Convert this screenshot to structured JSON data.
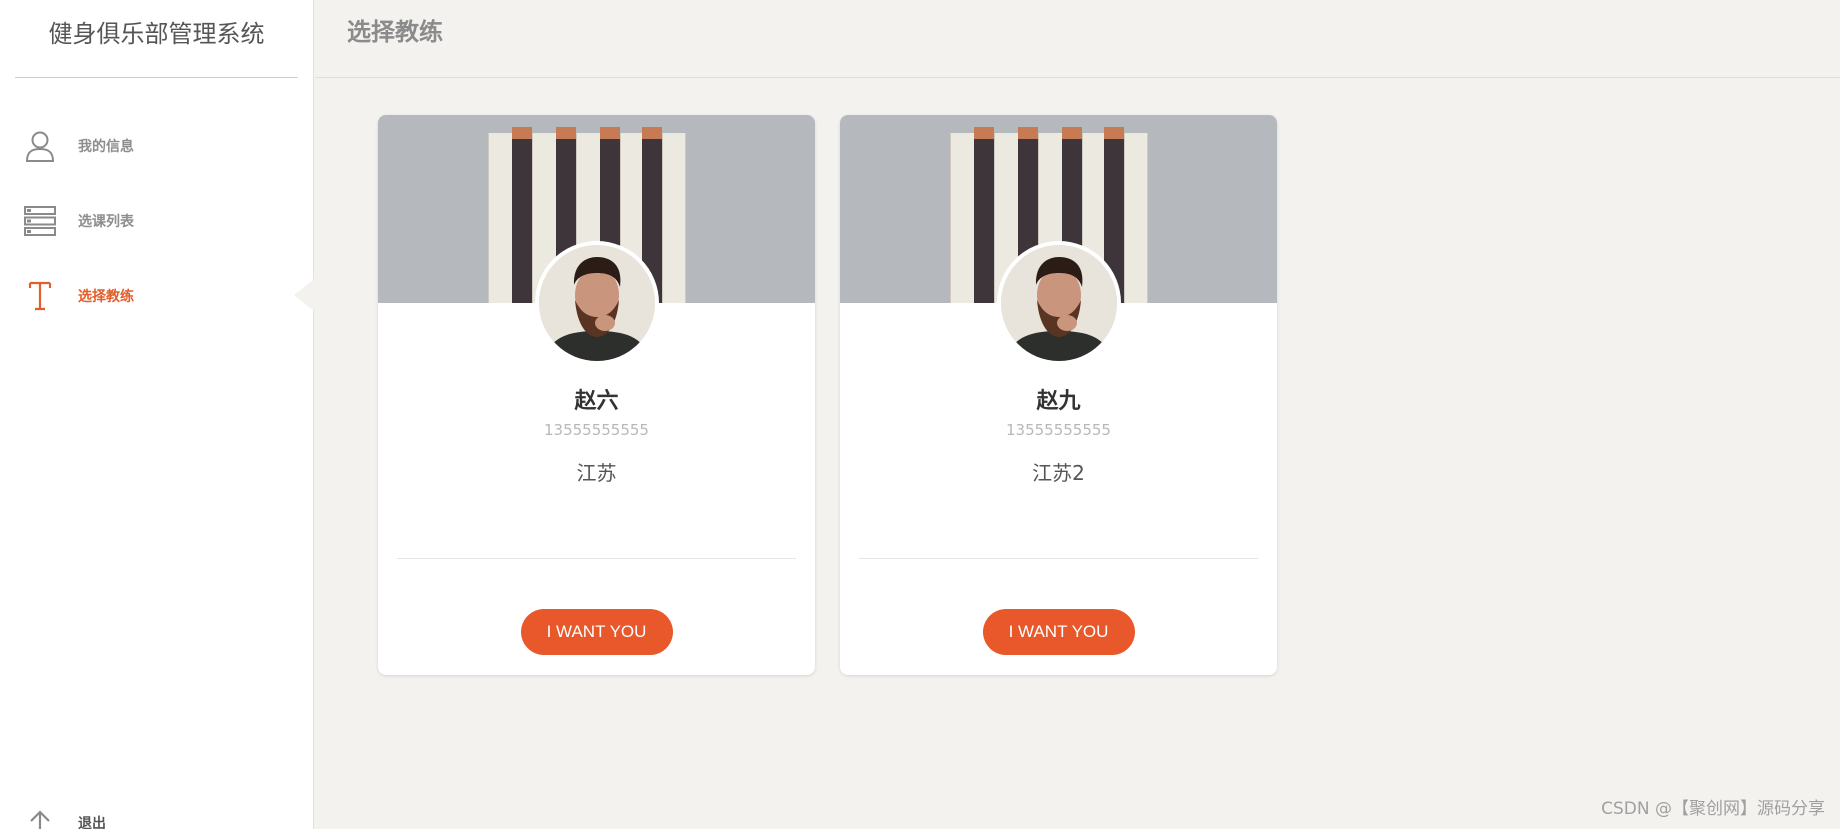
{
  "app": {
    "title": "健身俱乐部管理系统"
  },
  "sidebar": {
    "items": [
      {
        "label": "我的信息",
        "icon": "user-icon"
      },
      {
        "label": "选课列表",
        "icon": "list-icon"
      },
      {
        "label": "选择教练",
        "icon": "letter-t-icon",
        "active": true
      }
    ],
    "logout": {
      "label": "退出",
      "icon": "arrow-up-icon"
    }
  },
  "header": {
    "title": "选择教练"
  },
  "coaches": [
    {
      "name": "赵六",
      "phone": "13555555555",
      "region": "江苏",
      "button_label": "I WANT YOU"
    },
    {
      "name": "赵九",
      "phone": "13555555555",
      "region": "江苏2",
      "button_label": "I WANT YOU"
    }
  ],
  "watermark": "CSDN @【聚创网】源码分享",
  "colors": {
    "accent": "#e8582a",
    "active_nav": "#e25f2b",
    "background": "#f3f2ef"
  }
}
